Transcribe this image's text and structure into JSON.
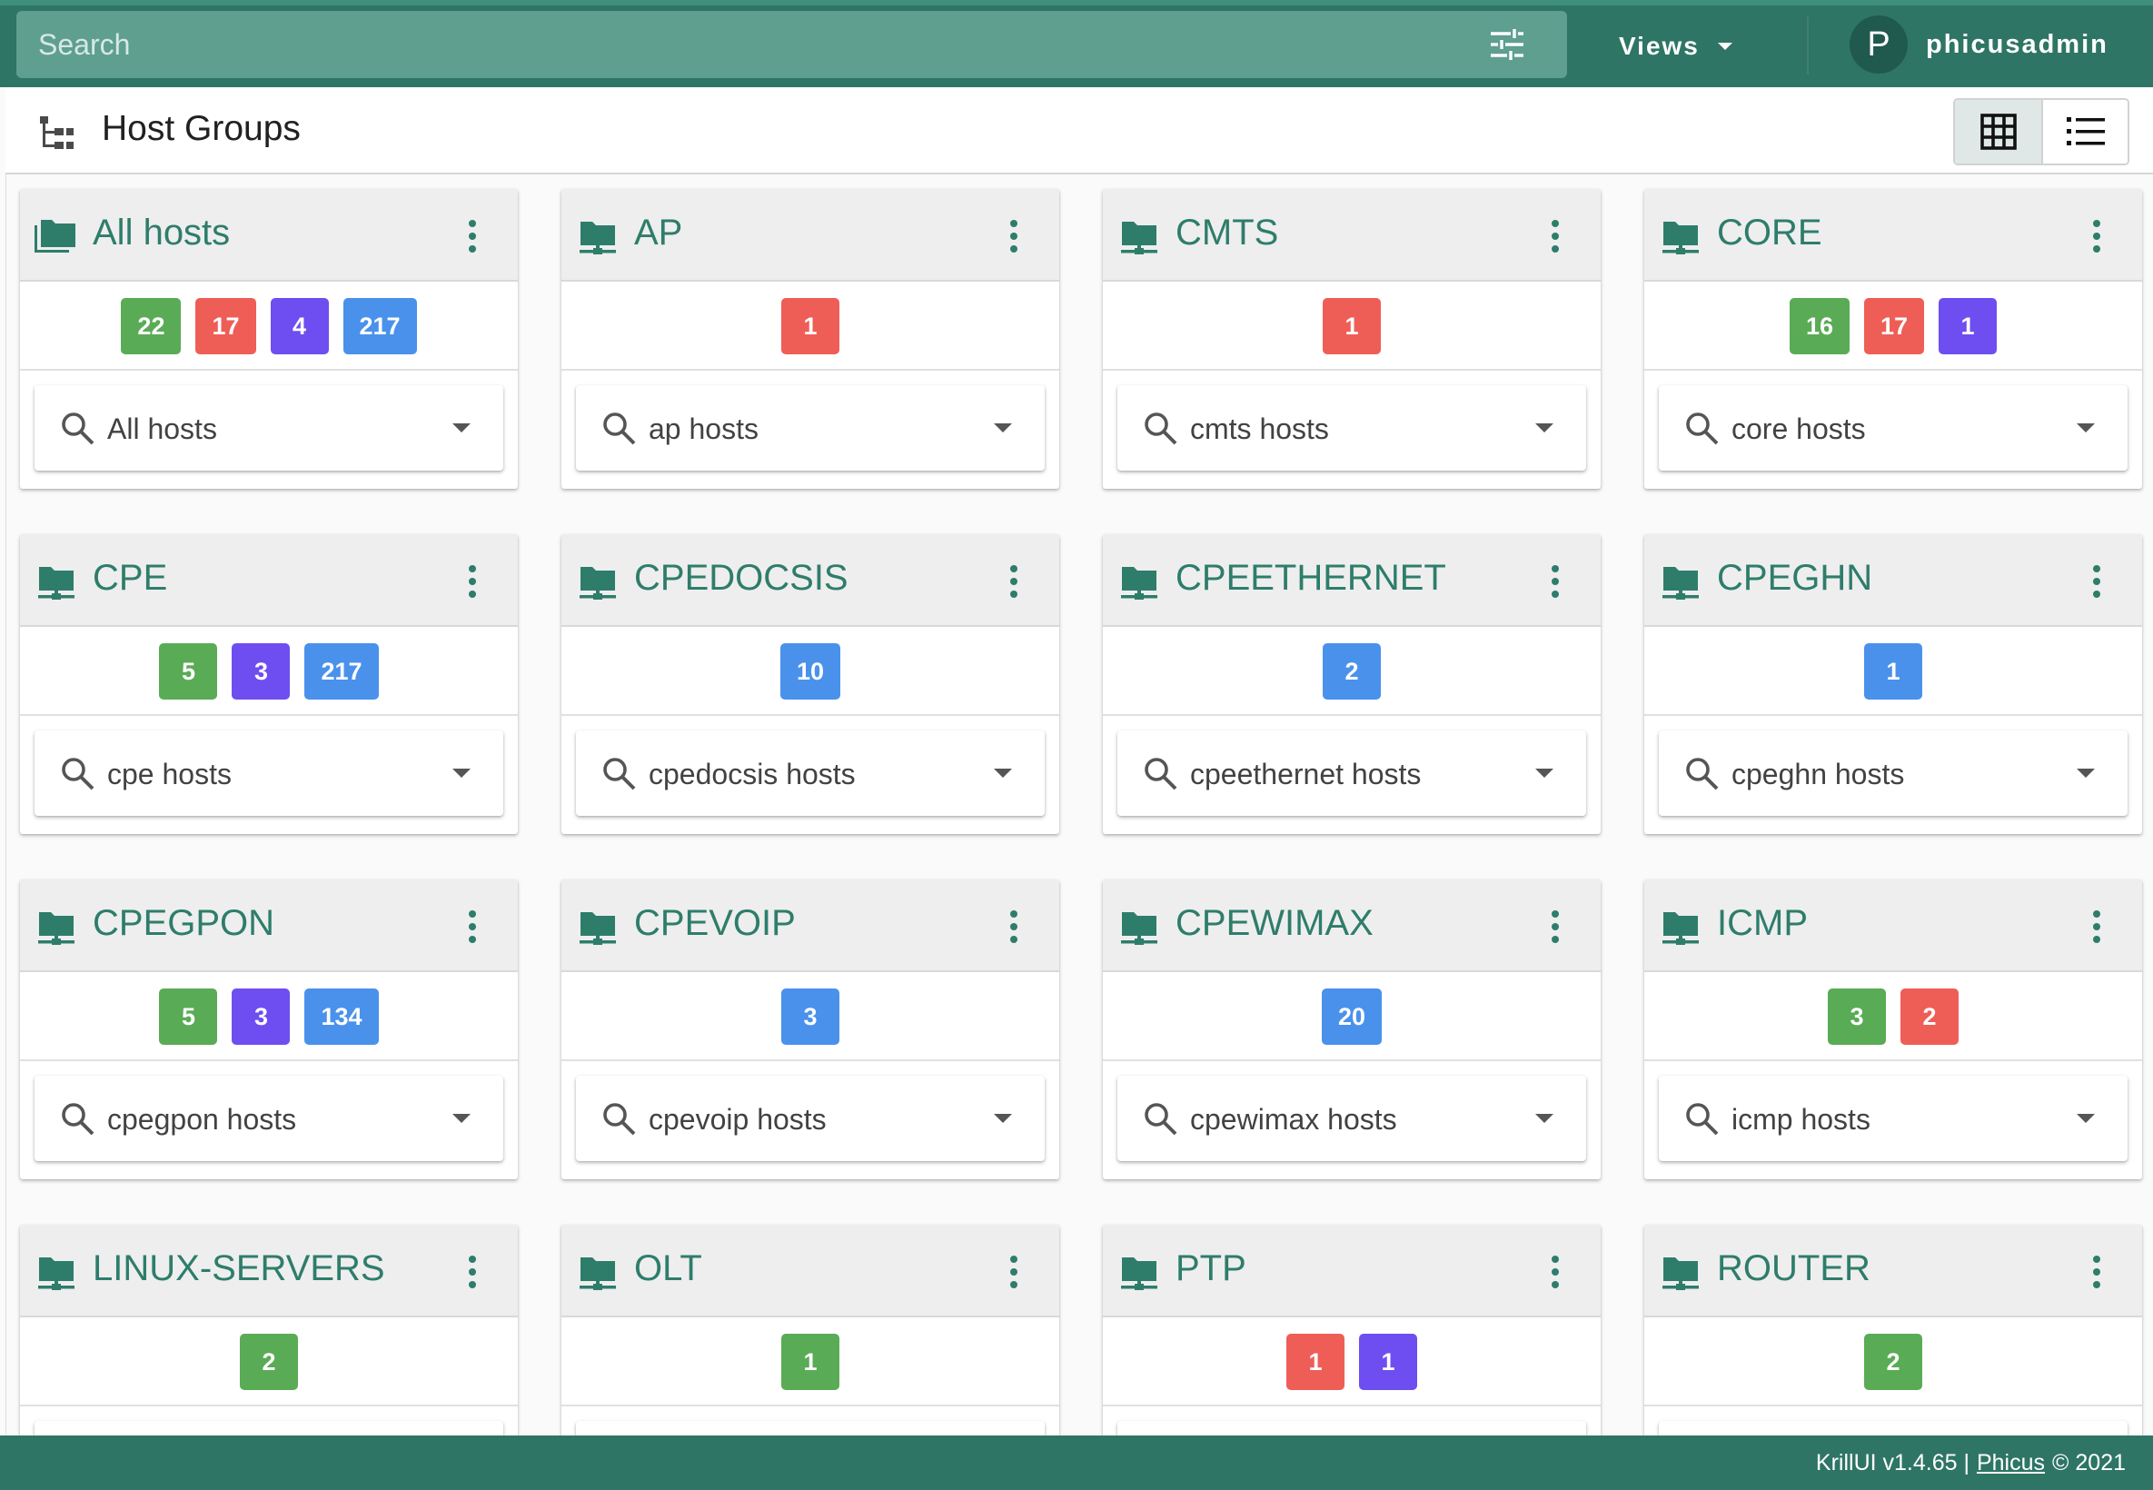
{
  "topbar": {
    "search_placeholder": "Search",
    "views_label": "Views",
    "user_initial": "P",
    "username": "phicusadmin"
  },
  "header": {
    "title": "Host Groups"
  },
  "colors": {
    "primary": "#2e7565",
    "title_green": "#2e7d6b",
    "badge_green": "#5aab55",
    "badge_red": "#ee5e56",
    "badge_purple": "#6e4ef0",
    "badge_blue": "#4a91ec"
  },
  "icons": {
    "filter": "tune-sliders-icon",
    "hierarchy": "hierarchy-tree-icon",
    "grid_view": "grid-view-icon",
    "list_view": "list-view-icon",
    "folder": "folder-network-icon",
    "folder_multiple": "folder-multiple-icon",
    "menu": "dots-vertical-icon",
    "search": "search-icon",
    "dropdown": "caret-down-icon"
  },
  "groups": [
    {
      "title": "All hosts",
      "icon": "folder-multiple",
      "badges": [
        {
          "value": "22",
          "color": "green"
        },
        {
          "value": "17",
          "color": "red"
        },
        {
          "value": "4",
          "color": "purple"
        },
        {
          "value": "217",
          "color": "blue"
        }
      ],
      "selector": "All hosts"
    },
    {
      "title": "AP",
      "icon": "folder-network",
      "badges": [
        {
          "value": "1",
          "color": "red"
        }
      ],
      "selector": "ap hosts"
    },
    {
      "title": "CMTS",
      "icon": "folder-network",
      "badges": [
        {
          "value": "1",
          "color": "red"
        }
      ],
      "selector": "cmts hosts"
    },
    {
      "title": "CORE",
      "icon": "folder-network",
      "badges": [
        {
          "value": "16",
          "color": "green"
        },
        {
          "value": "17",
          "color": "red"
        },
        {
          "value": "1",
          "color": "purple"
        }
      ],
      "selector": "core hosts"
    },
    {
      "title": "CPE",
      "icon": "folder-network",
      "badges": [
        {
          "value": "5",
          "color": "green"
        },
        {
          "value": "3",
          "color": "purple"
        },
        {
          "value": "217",
          "color": "blue"
        }
      ],
      "selector": "cpe hosts"
    },
    {
      "title": "CPEDOCSIS",
      "icon": "folder-network",
      "badges": [
        {
          "value": "10",
          "color": "blue"
        }
      ],
      "selector": "cpedocsis hosts"
    },
    {
      "title": "CPEETHERNET",
      "icon": "folder-network",
      "badges": [
        {
          "value": "2",
          "color": "blue"
        }
      ],
      "selector": "cpeethernet hosts"
    },
    {
      "title": "CPEGHN",
      "icon": "folder-network",
      "badges": [
        {
          "value": "1",
          "color": "blue"
        }
      ],
      "selector": "cpeghn hosts"
    },
    {
      "title": "CPEGPON",
      "icon": "folder-network",
      "badges": [
        {
          "value": "5",
          "color": "green"
        },
        {
          "value": "3",
          "color": "purple"
        },
        {
          "value": "134",
          "color": "blue"
        }
      ],
      "selector": "cpegpon hosts"
    },
    {
      "title": "CPEVOIP",
      "icon": "folder-network",
      "badges": [
        {
          "value": "3",
          "color": "blue"
        }
      ],
      "selector": "cpevoip hosts"
    },
    {
      "title": "CPEWIMAX",
      "icon": "folder-network",
      "badges": [
        {
          "value": "20",
          "color": "blue"
        }
      ],
      "selector": "cpewimax hosts"
    },
    {
      "title": "ICMP",
      "icon": "folder-network",
      "badges": [
        {
          "value": "3",
          "color": "green"
        },
        {
          "value": "2",
          "color": "red"
        }
      ],
      "selector": "icmp hosts"
    },
    {
      "title": "LINUX-SERVERS",
      "icon": "folder-network",
      "badges": [
        {
          "value": "2",
          "color": "green"
        }
      ],
      "selector": ""
    },
    {
      "title": "OLT",
      "icon": "folder-network",
      "badges": [
        {
          "value": "1",
          "color": "green"
        }
      ],
      "selector": ""
    },
    {
      "title": "PTP",
      "icon": "folder-network",
      "badges": [
        {
          "value": "1",
          "color": "red"
        },
        {
          "value": "1",
          "color": "purple"
        }
      ],
      "selector": ""
    },
    {
      "title": "ROUTER",
      "icon": "folder-network",
      "badges": [
        {
          "value": "2",
          "color": "green"
        }
      ],
      "selector": ""
    }
  ],
  "footer": {
    "prefix": "KrillUI v1.4.65 |",
    "link": "Phicus",
    "suffix": "© 2021"
  }
}
